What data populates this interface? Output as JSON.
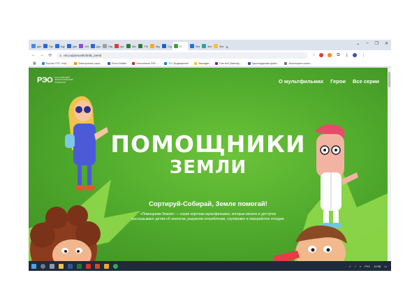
{
  "browser": {
    "tabs": [
      {
        "label": "Дети",
        "color": "#4285f4"
      },
      {
        "label": "Прог",
        "color": "#2b65d9"
      },
      {
        "label": "Курс",
        "color": "#1a73e8"
      },
      {
        "label": "Дет",
        "color": "#2b65d9"
      },
      {
        "label": "10Фи",
        "color": "#8f4bd1"
      },
      {
        "label": "Доп",
        "color": "#2b65d9"
      },
      {
        "label": "Нар",
        "color": "#9e9e9e"
      },
      {
        "label": "прог",
        "color": "#e53935"
      },
      {
        "label": "Мер",
        "color": "#2e7d32"
      },
      {
        "label": "ГЭС",
        "color": "#2e7d32"
      },
      {
        "label": "Мул",
        "color": "#f9a825"
      },
      {
        "label": "Сорт",
        "color": "#1565c0"
      },
      {
        "label": "П",
        "color": "#43a047",
        "active": true
      },
      {
        "label": "Зем",
        "color": "#1a73e8"
      },
      {
        "label": "Зем",
        "color": "#26a69a"
      },
      {
        "label": "Зем",
        "color": "#fbc02d"
      }
    ],
    "new_tab": "+",
    "window_controls": [
      "⌄",
      "–",
      "❐",
      "✕"
    ],
    "url": "reo.ru/pomoshchniki_zemli",
    "bookmarks": [
      {
        "label": "Портал ГПС «Упр...",
        "color": "#1e88e5"
      },
      {
        "label": "Электронное упра...",
        "color": "#fb8c00"
      },
      {
        "label": "Почта Майкл",
        "color": "#1565c0"
      },
      {
        "label": "Бесплатное РБУ ...",
        "color": "#c62828"
      },
      {
        "label": "TG Продвижение",
        "color": "#0288d1"
      },
      {
        "label": "Закладки",
        "color": "#fbc02d"
      },
      {
        "label": "Учет всё (Аватар) ...",
        "color": "#7b1fa2"
      },
      {
        "label": "Краснодарская файл...",
        "color": "#3949ab"
      },
      {
        "label": "Мониторинг клиен...",
        "color": "#757575"
      }
    ]
  },
  "site": {
    "logo": "РЭО",
    "logo_sub": "РОССИЙСКИЙ ЭКОЛОГИЧЕСКИЙ ОПЕРАТОР",
    "nav": [
      "О мультфильмах",
      "Герои",
      "Все серии"
    ],
    "title_line1": "ПОМОЩНИКИ",
    "title_line2": "ЗЕМЛИ",
    "slogan": "Сортируй-Собирай, Земле помогай!",
    "description": "«Помощники Земли» — серия коротких мультфильмов, которые весело и доступно рассказывают детям об экологии, разумном потреблении, сортировке и переработке отходов."
  },
  "taskbar": {
    "tray_lang": "РУС",
    "tray_time": "12:58"
  },
  "colors": {
    "page_green": "#4ea82b",
    "accent_green": "#8fd84a"
  }
}
